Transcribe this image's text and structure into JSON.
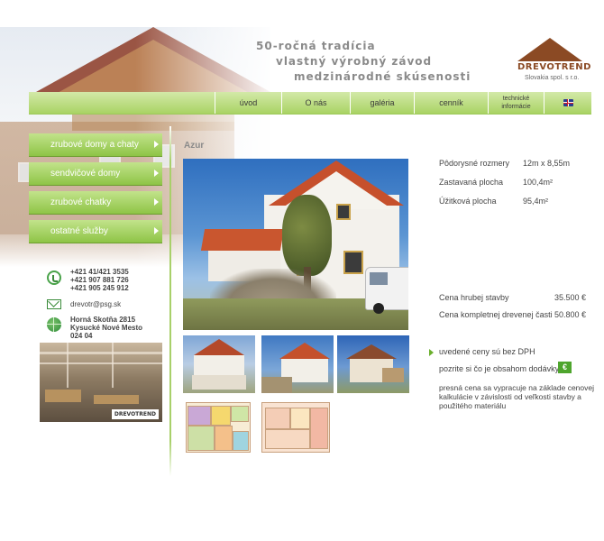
{
  "header": {
    "taglines": [
      "50-ročná tradícia",
      "vlastný výrobný závod",
      "medzinárodné skúsenosti"
    ],
    "logo": {
      "name": "DREVOTREND",
      "subtitle": "Slovakia spol. s r.o."
    }
  },
  "nav": {
    "items": [
      {
        "label": "úvod"
      },
      {
        "label": "O nás"
      },
      {
        "label": "galéria"
      },
      {
        "label": "cenník"
      },
      {
        "label": "technické informácie"
      }
    ],
    "flag_icon": "uk-flag-icon"
  },
  "sidebar": {
    "items": [
      {
        "label": "zrubové domy a chaty"
      },
      {
        "label": "sendvičové domy"
      },
      {
        "label": "zrubové chatky"
      },
      {
        "label": "ostatné služby"
      }
    ]
  },
  "contact": {
    "phones": [
      "+421 41/421 3535",
      "+421 907 881 726",
      "+421 905 245 912"
    ],
    "email": "drevotr@psg.sk",
    "address": [
      "Horná Skotňa 2815",
      "Kysucké Nové Mesto",
      "024 04"
    ],
    "factory_badge": "DREVOTREND",
    "icons": {
      "phone": "phone-icon",
      "mail": "mail-icon",
      "web": "globe-icon"
    }
  },
  "product": {
    "name": "Azur",
    "specs": [
      {
        "label": "Pôdorysné rozmery",
        "value": "12m x 8,55m"
      },
      {
        "label": "Zastavaná plocha",
        "value": "100,4m²"
      },
      {
        "label": "Úžitková plocha",
        "value": "95,4m²"
      }
    ],
    "prices": [
      {
        "label": "Cena hrubej stavby",
        "value": "35.500 €"
      },
      {
        "label": "Cena kompletnej drevenej časti",
        "value": "50.800 €"
      }
    ],
    "notes": {
      "vat": "uvedené ceny sú bez DPH",
      "delivery": "pozrite si čo je obsahom dodávky",
      "euro_button": "€",
      "paragraph": "presná cena sa vypracuje na základe cenovej kalkulácie v závislosti od veľkosti stavby a použitého materiálu"
    }
  },
  "colors": {
    "nav_green": "#a9d364",
    "menu_green": "#8ec446",
    "logo_brown": "#8b4a24",
    "accent_green": "#4ea52d"
  }
}
